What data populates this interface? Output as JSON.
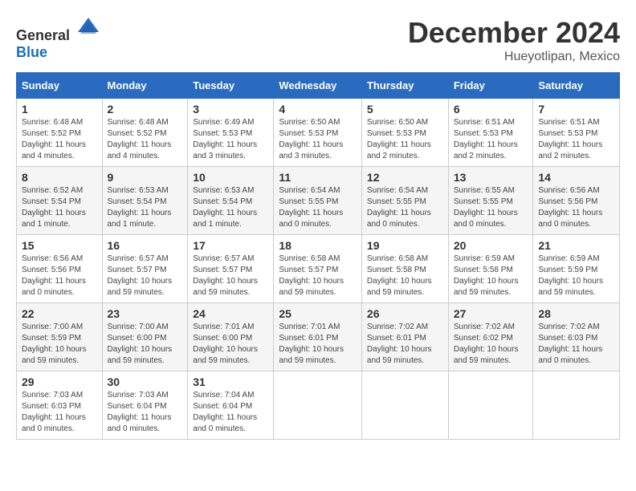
{
  "header": {
    "logo_general": "General",
    "logo_blue": "Blue",
    "month": "December 2024",
    "location": "Hueyotlipan, Mexico"
  },
  "days_of_week": [
    "Sunday",
    "Monday",
    "Tuesday",
    "Wednesday",
    "Thursday",
    "Friday",
    "Saturday"
  ],
  "weeks": [
    [
      {
        "day": "1",
        "info": "Sunrise: 6:48 AM\nSunset: 5:52 PM\nDaylight: 11 hours and 4 minutes."
      },
      {
        "day": "2",
        "info": "Sunrise: 6:48 AM\nSunset: 5:52 PM\nDaylight: 11 hours and 4 minutes."
      },
      {
        "day": "3",
        "info": "Sunrise: 6:49 AM\nSunset: 5:53 PM\nDaylight: 11 hours and 3 minutes."
      },
      {
        "day": "4",
        "info": "Sunrise: 6:50 AM\nSunset: 5:53 PM\nDaylight: 11 hours and 3 minutes."
      },
      {
        "day": "5",
        "info": "Sunrise: 6:50 AM\nSunset: 5:53 PM\nDaylight: 11 hours and 2 minutes."
      },
      {
        "day": "6",
        "info": "Sunrise: 6:51 AM\nSunset: 5:53 PM\nDaylight: 11 hours and 2 minutes."
      },
      {
        "day": "7",
        "info": "Sunrise: 6:51 AM\nSunset: 5:53 PM\nDaylight: 11 hours and 2 minutes."
      }
    ],
    [
      {
        "day": "8",
        "info": "Sunrise: 6:52 AM\nSunset: 5:54 PM\nDaylight: 11 hours and 1 minute."
      },
      {
        "day": "9",
        "info": "Sunrise: 6:53 AM\nSunset: 5:54 PM\nDaylight: 11 hours and 1 minute."
      },
      {
        "day": "10",
        "info": "Sunrise: 6:53 AM\nSunset: 5:54 PM\nDaylight: 11 hours and 1 minute."
      },
      {
        "day": "11",
        "info": "Sunrise: 6:54 AM\nSunset: 5:55 PM\nDaylight: 11 hours and 0 minutes."
      },
      {
        "day": "12",
        "info": "Sunrise: 6:54 AM\nSunset: 5:55 PM\nDaylight: 11 hours and 0 minutes."
      },
      {
        "day": "13",
        "info": "Sunrise: 6:55 AM\nSunset: 5:55 PM\nDaylight: 11 hours and 0 minutes."
      },
      {
        "day": "14",
        "info": "Sunrise: 6:56 AM\nSunset: 5:56 PM\nDaylight: 11 hours and 0 minutes."
      }
    ],
    [
      {
        "day": "15",
        "info": "Sunrise: 6:56 AM\nSunset: 5:56 PM\nDaylight: 11 hours and 0 minutes."
      },
      {
        "day": "16",
        "info": "Sunrise: 6:57 AM\nSunset: 5:57 PM\nDaylight: 10 hours and 59 minutes."
      },
      {
        "day": "17",
        "info": "Sunrise: 6:57 AM\nSunset: 5:57 PM\nDaylight: 10 hours and 59 minutes."
      },
      {
        "day": "18",
        "info": "Sunrise: 6:58 AM\nSunset: 5:57 PM\nDaylight: 10 hours and 59 minutes."
      },
      {
        "day": "19",
        "info": "Sunrise: 6:58 AM\nSunset: 5:58 PM\nDaylight: 10 hours and 59 minutes."
      },
      {
        "day": "20",
        "info": "Sunrise: 6:59 AM\nSunset: 5:58 PM\nDaylight: 10 hours and 59 minutes."
      },
      {
        "day": "21",
        "info": "Sunrise: 6:59 AM\nSunset: 5:59 PM\nDaylight: 10 hours and 59 minutes."
      }
    ],
    [
      {
        "day": "22",
        "info": "Sunrise: 7:00 AM\nSunset: 5:59 PM\nDaylight: 10 hours and 59 minutes."
      },
      {
        "day": "23",
        "info": "Sunrise: 7:00 AM\nSunset: 6:00 PM\nDaylight: 10 hours and 59 minutes."
      },
      {
        "day": "24",
        "info": "Sunrise: 7:01 AM\nSunset: 6:00 PM\nDaylight: 10 hours and 59 minutes."
      },
      {
        "day": "25",
        "info": "Sunrise: 7:01 AM\nSunset: 6:01 PM\nDaylight: 10 hours and 59 minutes."
      },
      {
        "day": "26",
        "info": "Sunrise: 7:02 AM\nSunset: 6:01 PM\nDaylight: 10 hours and 59 minutes."
      },
      {
        "day": "27",
        "info": "Sunrise: 7:02 AM\nSunset: 6:02 PM\nDaylight: 10 hours and 59 minutes."
      },
      {
        "day": "28",
        "info": "Sunrise: 7:02 AM\nSunset: 6:03 PM\nDaylight: 11 hours and 0 minutes."
      }
    ],
    [
      {
        "day": "29",
        "info": "Sunrise: 7:03 AM\nSunset: 6:03 PM\nDaylight: 11 hours and 0 minutes."
      },
      {
        "day": "30",
        "info": "Sunrise: 7:03 AM\nSunset: 6:04 PM\nDaylight: 11 hours and 0 minutes."
      },
      {
        "day": "31",
        "info": "Sunrise: 7:04 AM\nSunset: 6:04 PM\nDaylight: 11 hours and 0 minutes."
      },
      {
        "day": "",
        "info": ""
      },
      {
        "day": "",
        "info": ""
      },
      {
        "day": "",
        "info": ""
      },
      {
        "day": "",
        "info": ""
      }
    ]
  ]
}
